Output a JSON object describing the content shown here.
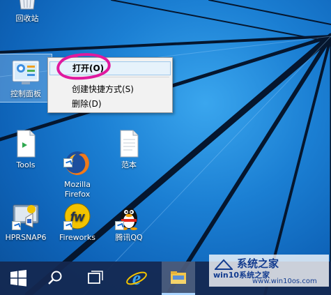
{
  "desktop": {
    "icons": [
      {
        "label": "回收站",
        "icon": "recycle-bin-icon"
      },
      {
        "label": "控制面板",
        "icon": "control-panel-icon"
      },
      {
        "label": "Tools",
        "icon": "document-icon"
      },
      {
        "label": "Mozilla\nFirefox",
        "icon": "firefox-icon"
      },
      {
        "label": "范本",
        "icon": "blank-document-icon"
      },
      {
        "label": "HPRSNAP6",
        "icon": "hprsnap-icon"
      },
      {
        "label": "Fireworks",
        "icon": "fireworks-icon"
      },
      {
        "label": "腾讯QQ",
        "icon": "qq-penguin-icon"
      }
    ]
  },
  "context_menu": {
    "items": [
      "打开(O)",
      "创建快捷方式(S)",
      "删除(D)"
    ],
    "highlighted_index": 0,
    "annotation_color": "#e0199e"
  },
  "taskbar": {
    "buttons": [
      "start-icon",
      "search-icon",
      "task-view-icon",
      "internet-explorer-icon",
      "file-explorer-icon"
    ],
    "active_index": 4
  },
  "watermark": {
    "title": "系统之家",
    "site": "win10系统之家",
    "url": "www.win10os.com"
  },
  "colors": {
    "desktop_blue": "#1b7fd3",
    "taskbar": "#142850",
    "menu_highlight": "#e6f2fb"
  }
}
